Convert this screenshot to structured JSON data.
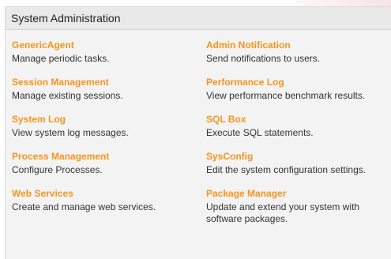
{
  "panel": {
    "title": "System Administration"
  },
  "modules": [
    {
      "title": "GenericAgent",
      "description": "Manage periodic tasks."
    },
    {
      "title": "Admin Notification",
      "description": "Send notifications to users."
    },
    {
      "title": "Session Management",
      "description": "Manage existing sessions."
    },
    {
      "title": "Performance Log",
      "description": "View performance benchmark results."
    },
    {
      "title": "System Log",
      "description": "View system log messages."
    },
    {
      "title": "SQL Box",
      "description": "Execute SQL statements."
    },
    {
      "title": "Process Management",
      "description": "Configure Processes."
    },
    {
      "title": "SysConfig",
      "description": "Edit the system configuration settings."
    },
    {
      "title": "Web Services",
      "description": "Create and manage web services."
    },
    {
      "title": "Package Manager",
      "description": "Update and extend your system with software packages."
    }
  ],
  "colors": {
    "link": "#f7941d",
    "text": "#333333",
    "header_bg": "#e9e9e9",
    "panel_bg": "#f3f3f3"
  }
}
